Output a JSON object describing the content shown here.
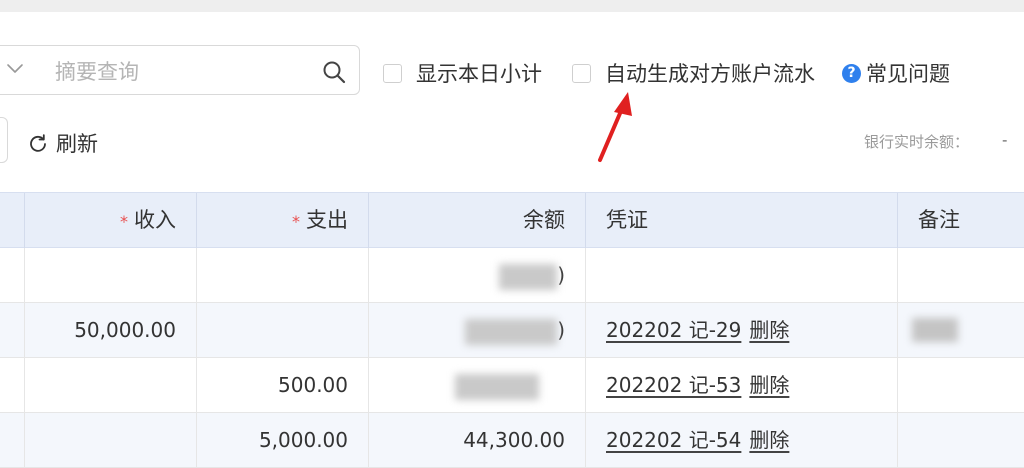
{
  "search": {
    "placeholder": "摘要查询",
    "value": ""
  },
  "toolbar": {
    "show_daily_subtotal": "显示本日小计",
    "auto_generate_counterparty": "自动生成对方账户流水",
    "faq": "常见问题",
    "refresh": "刷新",
    "bank_balance_label": "银行实时余额：",
    "bank_balance_value": "-"
  },
  "colors": {
    "header_bg": "#e8eef9",
    "alt_row_bg": "#f4f7fc",
    "required_star": "#e84e4e",
    "help_icon": "#2f80ed",
    "annotation_arrow": "#e02020"
  },
  "table": {
    "columns": {
      "income": "收入",
      "expense": "支出",
      "balance": "余额",
      "voucher": "凭证",
      "note": "备注"
    },
    "required_mark": "*",
    "delete_label": "删除",
    "rows": [
      {
        "income": "",
        "expense": "",
        "balance": ")",
        "voucher": ""
      },
      {
        "income": "50,000.00",
        "expense": "",
        "balance": ")",
        "voucher": "202202 记-29"
      },
      {
        "income": "",
        "expense": "500.00",
        "balance": "",
        "voucher": "202202 记-53"
      },
      {
        "income": "",
        "expense": "5,000.00",
        "balance": "44,300.00",
        "voucher": "202202 记-54"
      }
    ]
  }
}
